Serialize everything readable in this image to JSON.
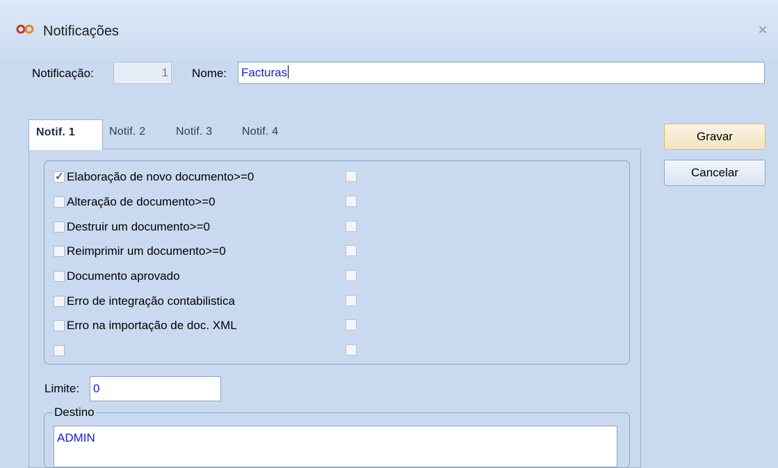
{
  "window": {
    "title": "Notificações",
    "close_label": "✕"
  },
  "header": {
    "notificacao_label": "Notificação:",
    "notificacao_value": "1",
    "nome_label": "Nome:",
    "nome_value": "Facturas"
  },
  "tabs": [
    {
      "label": "Notif. 1",
      "active": true
    },
    {
      "label": "Notif. 2",
      "active": false
    },
    {
      "label": "Notif. 3",
      "active": false
    },
    {
      "label": "Notif. 4",
      "active": false
    }
  ],
  "events": [
    {
      "label": "Elaboração de novo documento>=0",
      "checked": true
    },
    {
      "label": "Alteração de documento>=0",
      "checked": false
    },
    {
      "label": "Destruir um documento>=0",
      "checked": false
    },
    {
      "label": "Reimprimir um documento>=0",
      "checked": false
    },
    {
      "label": "Documento aprovado",
      "checked": false
    },
    {
      "label": "Erro de integração contabilistica",
      "checked": false
    },
    {
      "label": "Erro na importação de doc. XML",
      "checked": false
    },
    {
      "label": "",
      "checked": false
    }
  ],
  "limite": {
    "label": "Limite:",
    "value": "0"
  },
  "destino": {
    "legend": "Destino",
    "items": [
      "ADMIN"
    ]
  },
  "buttons": {
    "save": "Gravar",
    "cancel": "Cancelar"
  },
  "colors": {
    "background": "#c9daf0",
    "value_text": "#1a1ad6",
    "default_button_border": "#e2b55c"
  }
}
